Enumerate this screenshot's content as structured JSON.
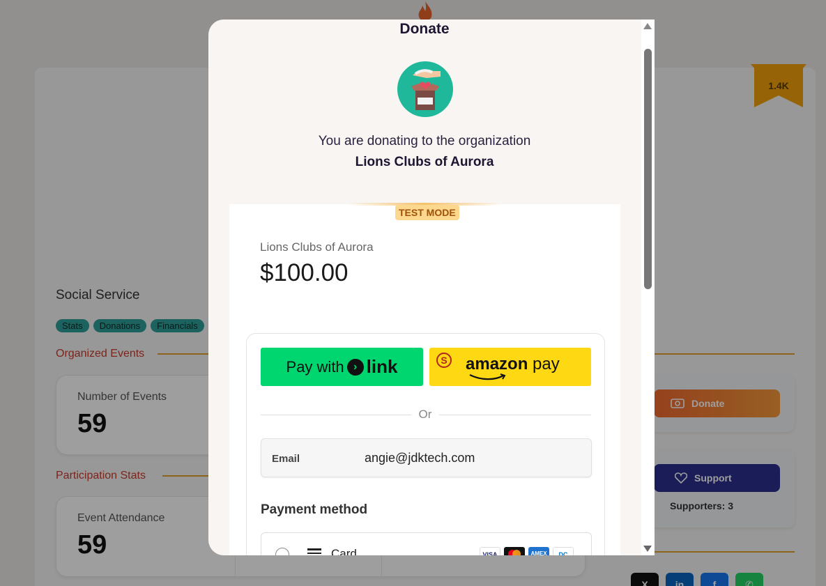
{
  "background": {
    "badge_count": "1.4K",
    "org_type": "Social Service",
    "tags": [
      "Stats",
      "Donations",
      "Financials"
    ],
    "sections": {
      "organized_events": "Organized Events",
      "participation_stats": "Participation Stats"
    },
    "stats": {
      "number_of_events_label": "Number of Events",
      "number_of_events_value": "59",
      "event_attendance_label": "Event Attendance",
      "event_attendance_value": "59"
    },
    "sidebar": {
      "donate_label": "Donate",
      "support_label": "Support",
      "supporters": "Supporters: 3"
    }
  },
  "modal": {
    "title": "Donate",
    "donating_text": "You are donating to the organization",
    "org_name": "Lions Clubs of Aurora"
  },
  "checkout": {
    "test_mode": "TEST MODE",
    "merchant": "Lions Clubs of Aurora",
    "amount": "$100.00",
    "link_button": {
      "prefix": "Pay with",
      "brand": "link"
    },
    "amazon_button": {
      "brand": "amazon",
      "suffix": "pay",
      "badge": "S"
    },
    "or_text": "Or",
    "email": {
      "label": "Email",
      "value": "angie@jdktech.com"
    },
    "payment_method_title": "Payment method",
    "card_label": "Card",
    "card_brands": [
      "VISA",
      "MC",
      "AMEX",
      "DC"
    ]
  },
  "colors": {
    "accent_orange": "#f06a30",
    "support_navy": "#2b2f8f",
    "link_green": "#00d66f",
    "amazon_yellow": "#ffd814",
    "section_red": "#c83a2c"
  }
}
